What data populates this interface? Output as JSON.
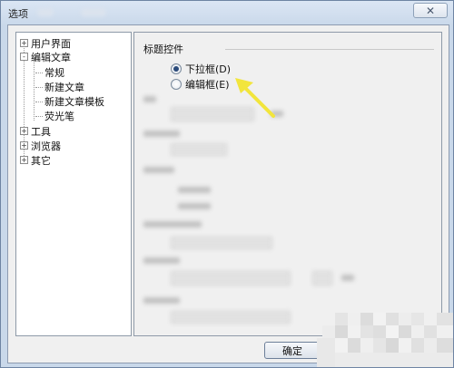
{
  "window": {
    "title": "选项",
    "close_glyph": "✕"
  },
  "tree": {
    "items": [
      {
        "label": "用户界面",
        "expander": "+"
      },
      {
        "label": "编辑文章",
        "expander": "-"
      },
      {
        "label": "常规"
      },
      {
        "label": "新建文章"
      },
      {
        "label": "新建文章模板"
      },
      {
        "label": "荧光笔"
      },
      {
        "label": "工具",
        "expander": "+"
      },
      {
        "label": "浏览器",
        "expander": "+"
      },
      {
        "label": "其它",
        "expander": "+"
      }
    ]
  },
  "panel": {
    "group_title": "标题控件",
    "options": [
      {
        "label": "下拉框(D)",
        "selected": true
      },
      {
        "label": "编辑框(E)",
        "selected": false
      }
    ]
  },
  "footer": {
    "ok_label": "确定"
  },
  "colors": {
    "arrow": "#f2e53c",
    "title_bar": "#c9d8ea"
  },
  "icons": [
    "close-icon",
    "tree-expander-icon",
    "radio-selected-icon",
    "radio-unselected-icon",
    "annotation-arrow-icon"
  ]
}
